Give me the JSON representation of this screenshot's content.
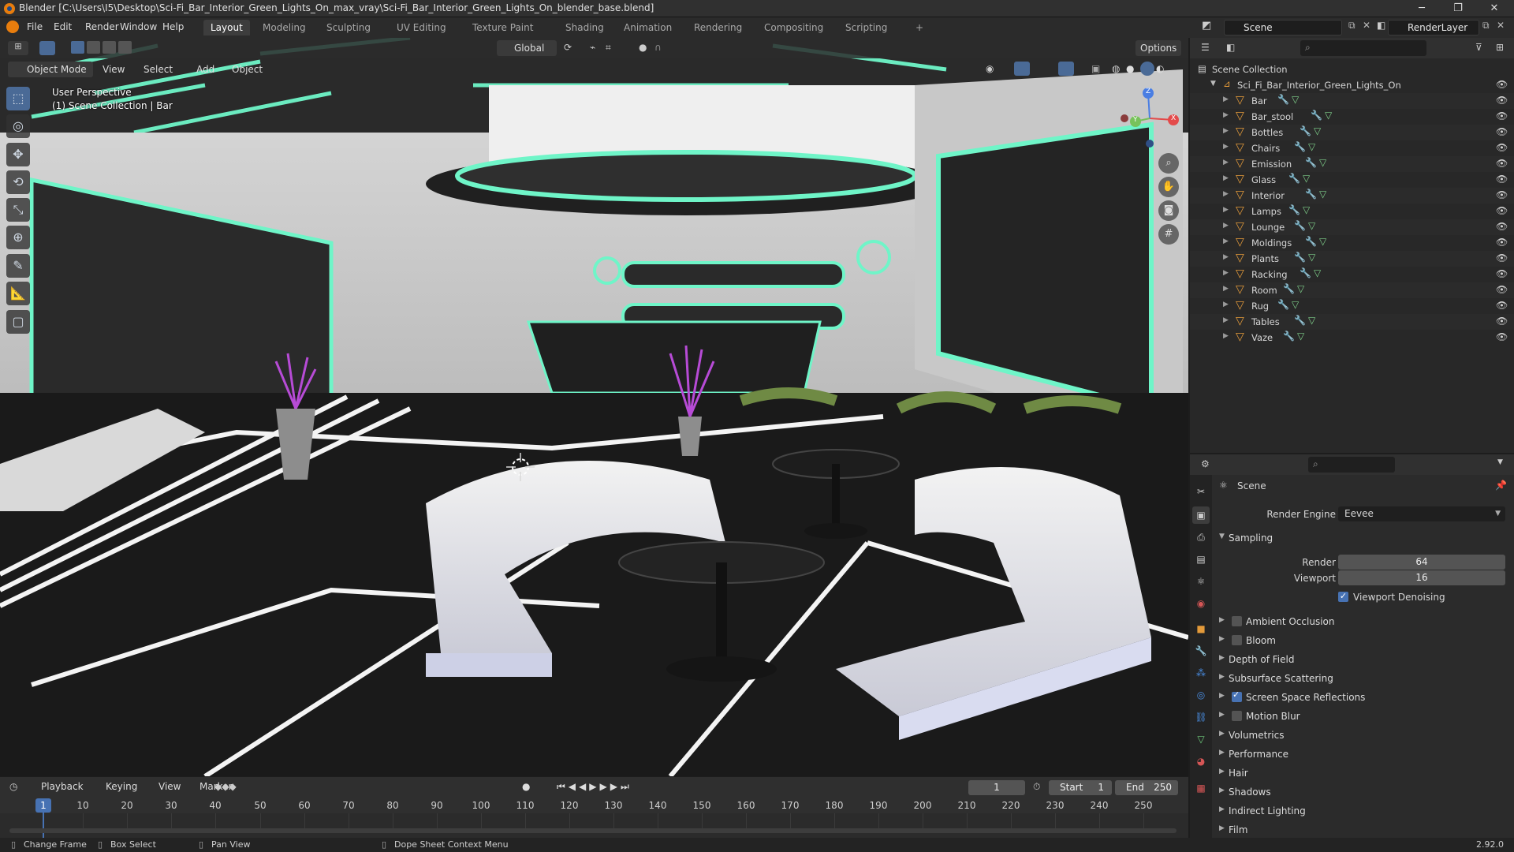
{
  "window": {
    "title": "Blender [C:\\Users\\I5\\Desktop\\Sci-Fi_Bar_Interior_Green_Lights_On_max_vray\\Sci-Fi_Bar_Interior_Green_Lights_On_blender_base.blend]",
    "minimize": "─",
    "maximize": "❐",
    "close": "✕"
  },
  "menubar": {
    "items": [
      "File",
      "Edit",
      "Render",
      "Window",
      "Help"
    ]
  },
  "workspaces": [
    "Layout",
    "Modeling",
    "Sculpting",
    "UV Editing",
    "Texture Paint",
    "Shading",
    "Animation",
    "Rendering",
    "Compositing",
    "Scripting"
  ],
  "workspace_add": "+",
  "scene_field": "Scene",
  "viewlayer_field": "RenderLayer",
  "tool_header": {
    "orientation": "Global",
    "options": "Options"
  },
  "viewport_header": {
    "mode": "Object Mode",
    "menus": [
      "View",
      "Select",
      "Add",
      "Object"
    ]
  },
  "viewport_overlay": {
    "perspective": "User Perspective",
    "collection": "(1) Scene Collection | Bar"
  },
  "gizmo": {
    "x": "X",
    "y": "Y",
    "z": "Z"
  },
  "outliner": {
    "root": "Scene Collection",
    "collection": "Sci_Fi_Bar_Interior_Green_Lights_On",
    "objects": [
      "Bar",
      "Bar_stool",
      "Bottles",
      "Chairs",
      "Emission",
      "Glass",
      "Interior",
      "Lamps",
      "Lounge",
      "Moldings",
      "Plants",
      "Racking",
      "Room",
      "Rug",
      "Tables",
      "Vaze"
    ]
  },
  "properties": {
    "context": "Scene",
    "render_engine_label": "Render Engine",
    "render_engine": "Eevee",
    "sampling_label": "Sampling",
    "render_label": "Render",
    "render_value": "64",
    "viewport_label": "Viewport",
    "viewport_value": "16",
    "viewport_denoising": "Viewport Denoising",
    "panels": [
      {
        "label": "Ambient Occlusion",
        "checkbox": true,
        "checked": false
      },
      {
        "label": "Bloom",
        "checkbox": true,
        "checked": false
      },
      {
        "label": "Depth of Field",
        "checkbox": false,
        "checked": false
      },
      {
        "label": "Subsurface Scattering",
        "checkbox": false,
        "checked": false
      },
      {
        "label": "Screen Space Reflections",
        "checkbox": true,
        "checked": true
      },
      {
        "label": "Motion Blur",
        "checkbox": true,
        "checked": false
      },
      {
        "label": "Volumetrics",
        "checkbox": false,
        "checked": false
      },
      {
        "label": "Performance",
        "checkbox": false,
        "checked": false
      },
      {
        "label": "Hair",
        "checkbox": false,
        "checked": false
      },
      {
        "label": "Shadows",
        "checkbox": false,
        "checked": false
      },
      {
        "label": "Indirect Lighting",
        "checkbox": false,
        "checked": false
      },
      {
        "label": "Film",
        "checkbox": false,
        "checked": false
      }
    ]
  },
  "timeline": {
    "menus": [
      "Playback",
      "Keying",
      "View",
      "Marker"
    ],
    "current_frame": "1",
    "start_label": "Start",
    "start": "1",
    "end_label": "End",
    "end": "250",
    "ticks": [
      "10",
      "20",
      "30",
      "40",
      "50",
      "60",
      "70",
      "80",
      "90",
      "100",
      "110",
      "120",
      "130",
      "140",
      "150",
      "160",
      "170",
      "180",
      "190",
      "200",
      "210",
      "220",
      "230",
      "240",
      "250"
    ],
    "playhead": "1"
  },
  "statusbar": {
    "items": [
      "Change Frame",
      "Box Select",
      "Pan View",
      "Dope Sheet Context Menu"
    ],
    "version": "2.92.0"
  },
  "colors": {
    "accent": "#4772b3",
    "neon": "#6ff5c8",
    "object_icon": "#e39a3a"
  }
}
